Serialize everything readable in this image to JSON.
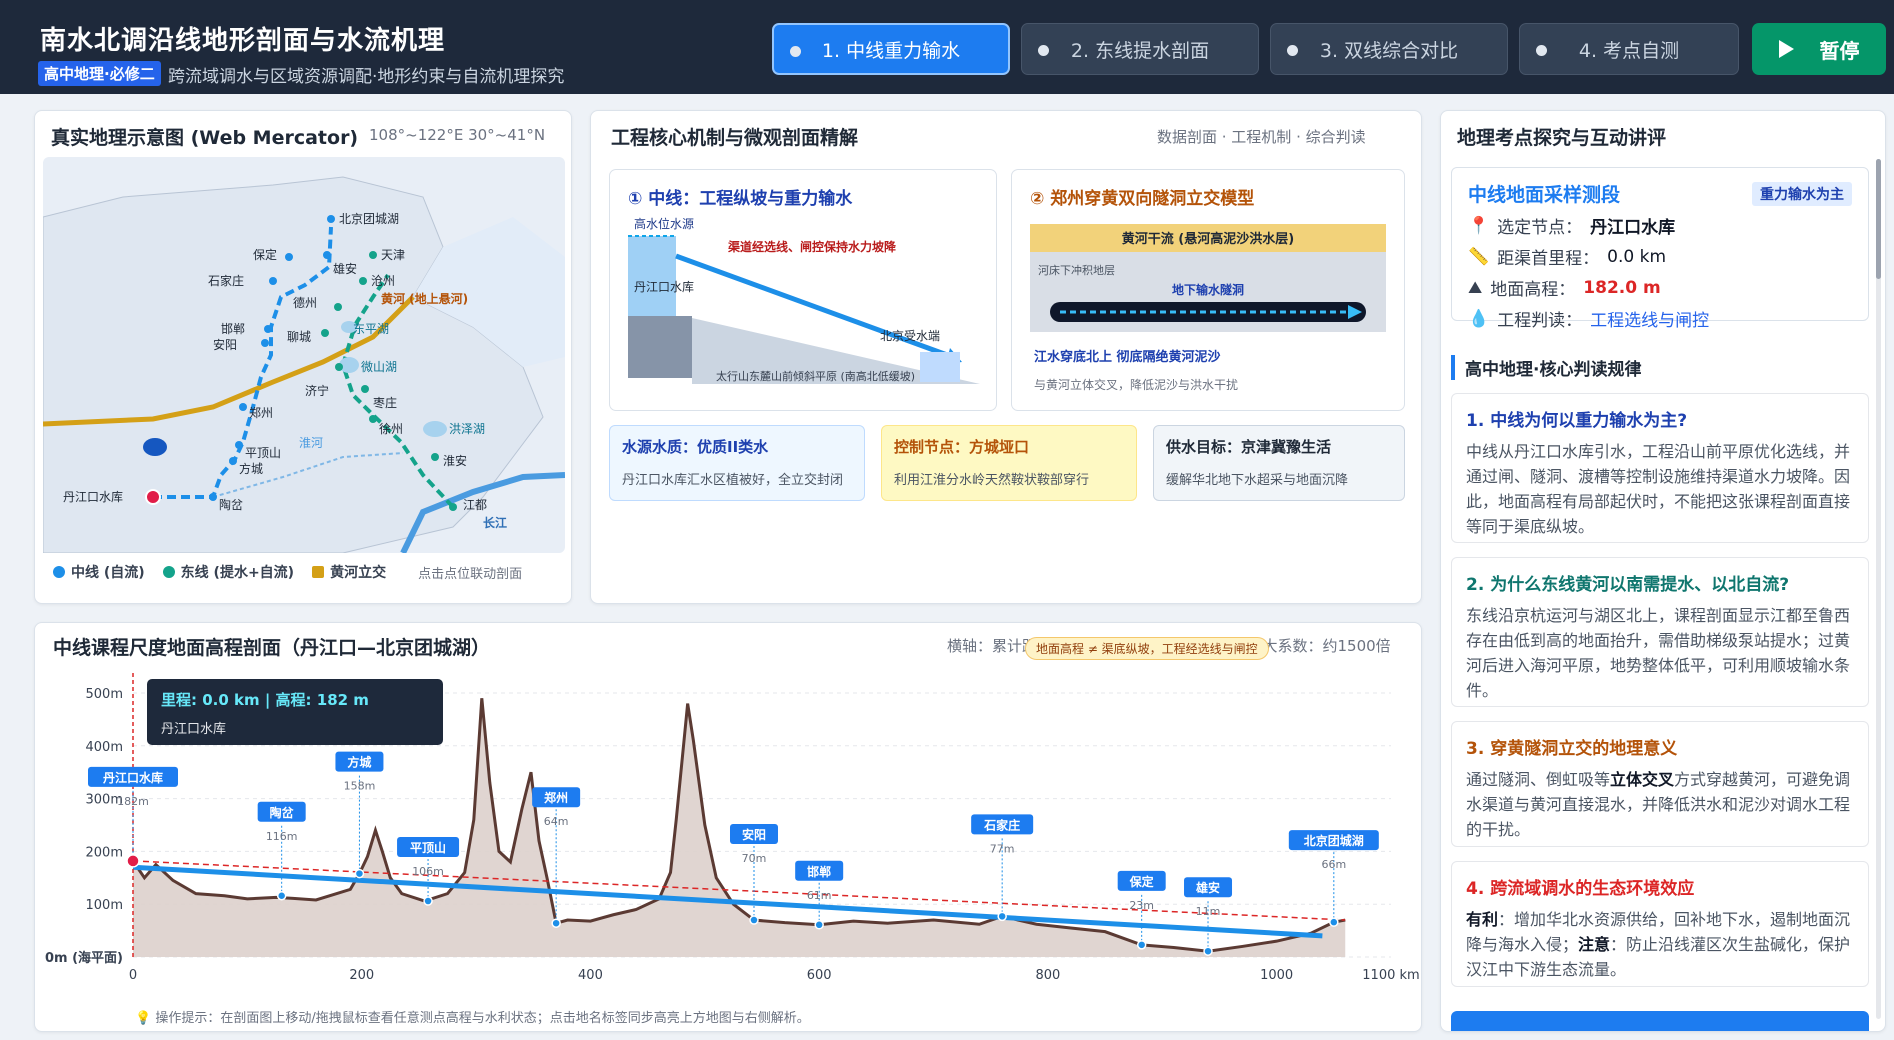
{
  "header": {
    "title": "南水北调沿线地形剖面与水流机理",
    "badge": "高中地理·必修二",
    "subtitle": "跨流域调水与区域资源调配·地形约束与自流机理探究",
    "tabs": [
      {
        "label": "1. 中线重力输水"
      },
      {
        "label": "2. 东线提水剖面"
      },
      {
        "label": "3. 双线综合对比"
      },
      {
        "label": "4. 考点自测"
      }
    ],
    "pause_label": "暂停"
  },
  "map": {
    "title": "真实地理示意图 (Web Mercator)",
    "range": "108°~122°E 30°~41°N",
    "cities": [
      "北京团城湖",
      "天津",
      "保定",
      "雄安",
      "沧州",
      "石家庄",
      "德州",
      "东平湖",
      "黄河 (地上悬河)",
      "邯郸",
      "安阳",
      "聊城",
      "微山湖",
      "济宁",
      "枣庄",
      "郑州",
      "洪泽湖",
      "徐州",
      "平顶山",
      "淮河",
      "方城",
      "淮安",
      "丹江口水库",
      "陶岔",
      "江都",
      "长江"
    ],
    "legend": {
      "middle": "中线 (自流)",
      "east": "东线 (提水+自流)",
      "yellow": "黄河立交",
      "hint": "点击点位联动剖面"
    }
  },
  "mech": {
    "title": "工程核心机制与微观剖面精解",
    "meta": "数据剖面 · 工程机制 · 综合判读",
    "card1": {
      "title": "① 中线：工程纵坡与重力输水",
      "high": "高水位水源",
      "note": "渠道经选线、闸控保持水力坡降",
      "reservoir": "丹江口水库",
      "end": "北京受水端",
      "plain": "太行山东麓山前倾斜平原 (南高北低缓坡)"
    },
    "card2": {
      "title": "② 郑州穿黄双向隧洞立交模型",
      "river": "黄河干流 (悬河高泥沙洪水层)",
      "bed": "河床下冲积地层",
      "tunnel": "地下输水隧洞",
      "main": "江水穿底北上 彻底隔绝黄河泥沙",
      "sub": "与黄河立体交叉，降低泥沙与洪水干扰"
    },
    "boxes": [
      {
        "t": "水源水质：优质II类水",
        "d": "丹江口水库汇水区植被好，全立交封闭"
      },
      {
        "t": "控制节点：方城垭口",
        "d": "利用江淮分水岭天然鞍状鞍部穿行"
      },
      {
        "t": "供水目标：京津冀豫生活",
        "d": "缓解华北地下水超采与地面沉降"
      }
    ]
  },
  "profile": {
    "title": "中线课程尺度地面高程剖面（丹江口—北京团城湖）",
    "axis_note": "横轴：累计距离(km) | 纵轴：高程(m) | 垂直夸大系数：约1500倍",
    "warn": "地面高程 ≠ 渠底纵坡，工程经选线与闸控",
    "tooltip": {
      "main": "里程: 0.0 km | 高程: 182 m",
      "sub": "丹江口水库"
    },
    "yticks": [
      "500m",
      "400m",
      "300m",
      "200m",
      "100m",
      "0m (海平面)"
    ],
    "xticks": [
      "0",
      "200",
      "400",
      "600",
      "800",
      "1000",
      "1100 km"
    ],
    "hint": "操作提示：在剖面图上移动/拖拽鼠标查看任意测点高程与水利状态；点击地名标签同步高亮上方地图与右侧解析。"
  },
  "chart_data": {
    "type": "line",
    "title": "中线课程尺度地面高程剖面（丹江口—北京团城湖）",
    "xlabel": "累计距离(km)",
    "ylabel": "高程(m)",
    "xlim": [
      0,
      1100
    ],
    "ylim": [
      0,
      500
    ],
    "stations": [
      {
        "name": "丹江口水库",
        "x": 0,
        "y": 182
      },
      {
        "name": "陶岔",
        "x": 130,
        "y": 116
      },
      {
        "name": "方城",
        "x": 198,
        "y": 158
      },
      {
        "name": "平顶山",
        "x": 258,
        "y": 106
      },
      {
        "name": "郑州",
        "x": 370,
        "y": 64
      },
      {
        "name": "安阳",
        "x": 543,
        "y": 70
      },
      {
        "name": "邯郸",
        "x": 600,
        "y": 61
      },
      {
        "name": "石家庄",
        "x": 760,
        "y": 77
      },
      {
        "name": "保定",
        "x": 882,
        "y": 23
      },
      {
        "name": "雄安",
        "x": 940,
        "y": 11
      },
      {
        "name": "北京团城湖",
        "x": 1050,
        "y": 66
      }
    ],
    "ground": [
      [
        0,
        182
      ],
      [
        10,
        150
      ],
      [
        20,
        175
      ],
      [
        35,
        145
      ],
      [
        55,
        120
      ],
      [
        80,
        116
      ],
      [
        100,
        110
      ],
      [
        125,
        113
      ],
      [
        140,
        111
      ],
      [
        160,
        108
      ],
      [
        175,
        118
      ],
      [
        190,
        128
      ],
      [
        198,
        158
      ],
      [
        205,
        190
      ],
      [
        212,
        240
      ],
      [
        218,
        200
      ],
      [
        225,
        150
      ],
      [
        235,
        120
      ],
      [
        255,
        106
      ],
      [
        275,
        120
      ],
      [
        290,
        160
      ],
      [
        298,
        260
      ],
      [
        305,
        490
      ],
      [
        312,
        330
      ],
      [
        320,
        200
      ],
      [
        330,
        180
      ],
      [
        340,
        280
      ],
      [
        348,
        350
      ],
      [
        355,
        220
      ],
      [
        362,
        150
      ],
      [
        370,
        64
      ],
      [
        380,
        70
      ],
      [
        400,
        68
      ],
      [
        420,
        80
      ],
      [
        440,
        90
      ],
      [
        460,
        110
      ],
      [
        470,
        160
      ],
      [
        475,
        260
      ],
      [
        480,
        370
      ],
      [
        485,
        480
      ],
      [
        490,
        410
      ],
      [
        500,
        250
      ],
      [
        510,
        150
      ],
      [
        525,
        100
      ],
      [
        543,
        70
      ],
      [
        570,
        65
      ],
      [
        600,
        61
      ],
      [
        630,
        68
      ],
      [
        660,
        64
      ],
      [
        700,
        70
      ],
      [
        740,
        62
      ],
      [
        760,
        77
      ],
      [
        790,
        62
      ],
      [
        820,
        55
      ],
      [
        850,
        48
      ],
      [
        882,
        23
      ],
      [
        910,
        18
      ],
      [
        940,
        11
      ],
      [
        970,
        20
      ],
      [
        1000,
        30
      ],
      [
        1030,
        45
      ],
      [
        1050,
        66
      ],
      [
        1060,
        70
      ]
    ],
    "canal": [
      [
        0,
        170
      ],
      [
        1040,
        40
      ]
    ],
    "trend": [
      [
        0,
        182
      ],
      [
        1060,
        70
      ]
    ]
  },
  "right": {
    "title": "地理考点探究与互动讲评",
    "sample": {
      "title": "中线地面采样测段",
      "tag": "重力输水为主",
      "node_l": "选定节点：",
      "node_v": "丹江口水库",
      "dist_l": "距渠首里程：",
      "dist_v": "0.0 km",
      "elev_l": "地面高程：",
      "elev_v": "182.0 m",
      "judge_l": "工程判读：",
      "judge_v": "工程选线与闸控"
    },
    "rules_title": "高中地理·核心判读规律",
    "q": [
      {
        "t": "1. 中线为何以重力输水为主?",
        "a": "中线从丹江口水库引水，工程沿山前平原优化选线，并通过闸、隧洞、渡槽等控制设施维持渠道水力坡降。因此，地面高程有局部起伏时，不能把这张课程剖面直接等同于渠底纵坡。"
      },
      {
        "t": "2. 为什么东线黄河以南需提水、以北自流?",
        "a": "东线沿京杭运河与湖区北上，课程剖面显示江都至鲁西存在由低到高的地面抬升，需借助梯级泵站提水；过黄河后进入海河平原，地势整体低平，可利用顺坡输水条件。"
      },
      {
        "t": "3. 穿黄隧洞立交的地理意义",
        "a1": "通过隧洞、倒虹吸等",
        "a2": "立体交叉",
        "a3": "方式穿越黄河，可避免调水渠道与黄河直接混水，并降低洪水和泥沙对调水工程的干扰。"
      },
      {
        "t": "4. 跨流域调水的生态环境效应",
        "p1": "有利",
        "a1": "：增加华北水资源供给，回补地下水，遏制地面沉降与海水入侵；",
        "p2": "注意",
        "a2": "：防止沿线灌区次生盐碱化，保护汉江中下游生态流量。"
      }
    ]
  },
  "colors": {
    "middle": "#1d8fe8",
    "east": "#14a38b",
    "yellow": "#d4a017",
    "header": "#1e293b"
  }
}
